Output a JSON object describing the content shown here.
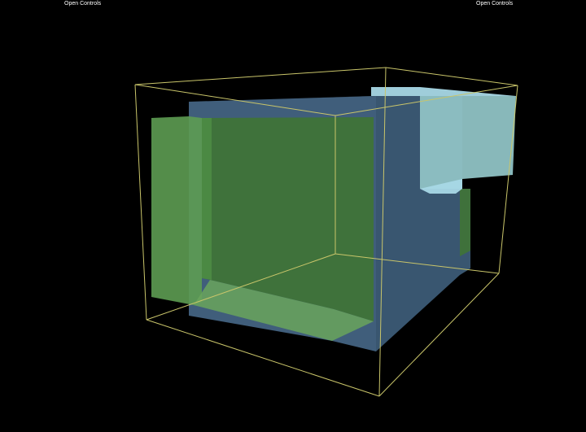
{
  "controls": {
    "left_label": "Open Controls",
    "right_label": "Open Controls"
  },
  "scene": {
    "background": "#000000",
    "colors": {
      "wireframe": "#c9c56a",
      "green_box": "#4f8f46",
      "green_box_light": "#6aa55c",
      "blue_box": "#4b6f91",
      "blue_box_light": "#6a8fb0",
      "cyan_box": "#8fc2c4",
      "cyan_box_light": "#a8d8e6"
    }
  }
}
